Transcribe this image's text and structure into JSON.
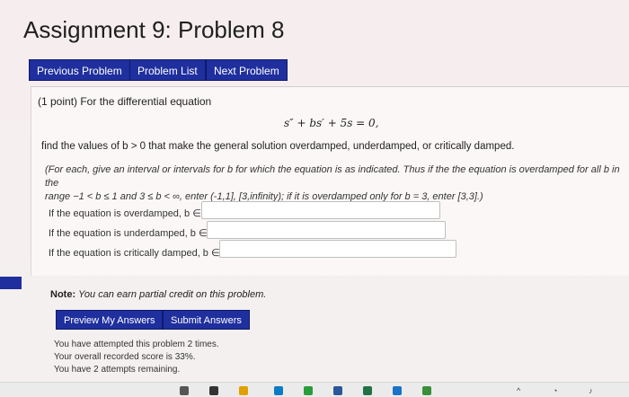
{
  "header": {
    "title": "Assignment 9: Problem 8"
  },
  "nav": {
    "previous": "Previous Problem",
    "list": "Problem List",
    "next": "Next Problem"
  },
  "problem": {
    "intro": "(1 point) For the differential equation",
    "equation": "s″ + bs′ + 5s = 0,",
    "find": "find the values of b > 0 that make the general solution overdamped, underdamped, or critically damped.",
    "instructions_line1": "(For each, give an interval or intervals for b for which the equation is as indicated. Thus if the the equation is overdamped for all b in the",
    "instructions_line2": "range −1 < b ≤ 1 and 3 ≤ b < ∞, enter (-1,1], [3,infinity); if it is overdamped only for b = 3, enter [3,3].)",
    "rows": [
      {
        "label": "If the equation is overdamped, b ∈",
        "value": ""
      },
      {
        "label": "If the equation is underdamped, b ∈",
        "value": ""
      },
      {
        "label": "If the equation is critically damped, b ∈",
        "value": ""
      }
    ]
  },
  "note": {
    "bold": "Note:",
    "text": "You can earn partial credit on this problem."
  },
  "actions": {
    "preview": "Preview My Answers",
    "submit": "Submit Answers"
  },
  "status": {
    "attempted": "You have attempted this problem 2 times.",
    "score": "Your overall recorded score is 33%.",
    "remaining": "You have 2 attempts remaining."
  },
  "colors": {
    "accent": "#1f2f9e",
    "background": "#f6eeee"
  },
  "taskbar": {
    "tray_icons": [
      "chevron-up-icon",
      "wifi-icon",
      "speaker-icon"
    ]
  }
}
